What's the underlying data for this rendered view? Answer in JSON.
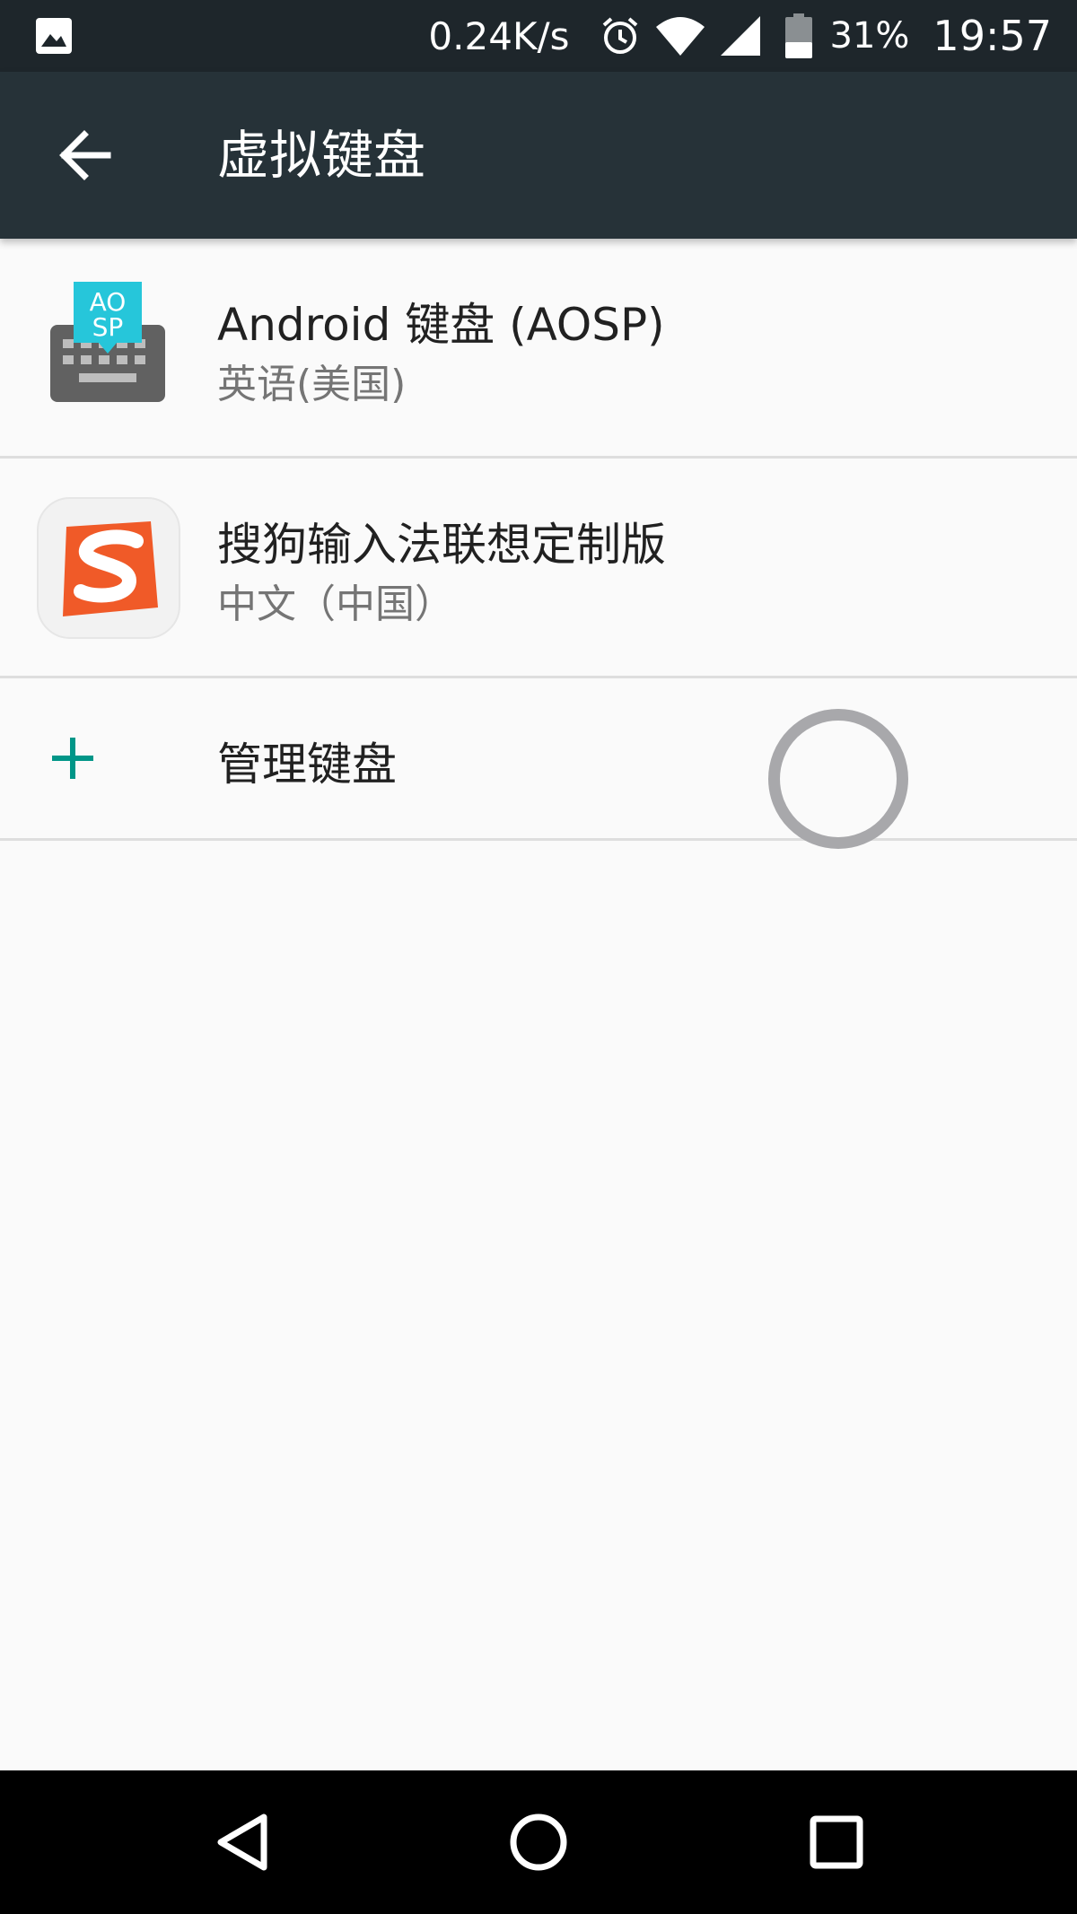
{
  "status_bar": {
    "network_speed": "0.24K/s",
    "battery_percent": "31%",
    "time": "19:57",
    "icons": [
      "image-notification-icon",
      "alarm-icon",
      "wifi-icon",
      "cell-signal-icon",
      "battery-icon"
    ]
  },
  "app_bar": {
    "title": "虚拟键盘",
    "back_icon": "arrow-back-icon"
  },
  "keyboards": [
    {
      "title": "Android 键盘 (AOSP)",
      "subtitle": "英语(美国)",
      "icon": "aosp-keyboard-icon"
    },
    {
      "title": "搜狗输入法联想定制版",
      "subtitle": "中文（中国）",
      "icon": "sogou-icon"
    }
  ],
  "manage": {
    "label": "管理键盘",
    "icon": "plus-icon"
  },
  "nav_bar": {
    "icons": [
      "back-triangle-icon",
      "home-circle-icon",
      "recents-square-icon"
    ]
  },
  "colors": {
    "status_bar_bg": "#1e262b",
    "app_bar_bg": "#263238",
    "page_bg": "#fafafa",
    "accent": "#009688",
    "aosp_badge": "#26c6da",
    "sogou_orange": "#f05a28"
  }
}
